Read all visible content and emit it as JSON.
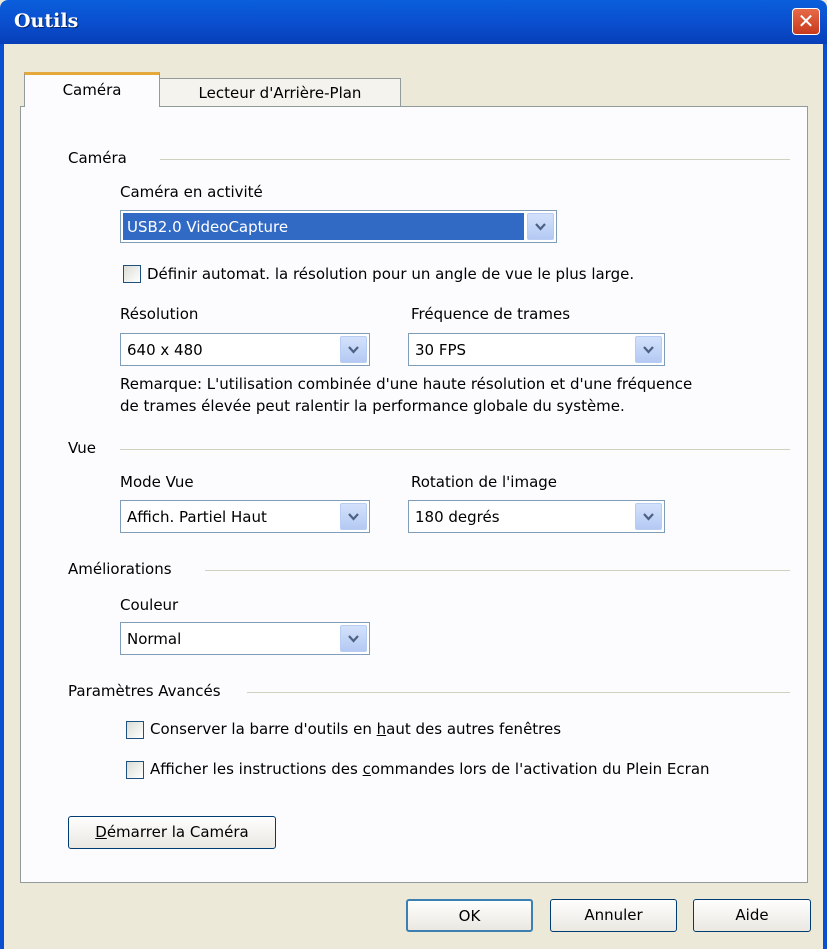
{
  "window": {
    "title": "Outils",
    "close_label": "✕"
  },
  "tabs": [
    {
      "label": "Caméra",
      "active": true
    },
    {
      "label": "Lecteur d'Arrière-Plan",
      "active": false
    }
  ],
  "camera_section": {
    "title": "Caméra",
    "active_camera_label": "Caméra en activité",
    "active_camera_value": "USB2.0 VideoCapture",
    "auto_resolution_checkbox": {
      "label": "Définir automat. la résolution pour un angle de vue le plus large.",
      "checked": false
    },
    "resolution_label": "Résolution",
    "resolution_value": "640 x 480",
    "framerate_label": "Fréquence de trames",
    "framerate_value": "30 FPS",
    "note_line1": "Remarque: L'utilisation combinée d'une haute résolution et d'une fréquence",
    "note_line2": "de trames élevée peut ralentir la performance globale du système."
  },
  "view_section": {
    "title": "Vue",
    "mode_label": "Mode Vue",
    "mode_value": "Affich. Partiel Haut",
    "rotation_label": "Rotation de l'image",
    "rotation_value": "180 degrés"
  },
  "enhancements_section": {
    "title": "Améliorations",
    "color_label": "Couleur",
    "color_value": "Normal"
  },
  "advanced_section": {
    "title": "Paramètres Avancés",
    "keep_on_top": {
      "label_pre": "Conserver la barre d'outils en ",
      "label_mnemonic": "h",
      "label_post": "aut des autres fenêtres",
      "checked": false
    },
    "show_instructions": {
      "label_pre": "Afficher les instructions des ",
      "label_mnemonic": "c",
      "label_post": "ommandes lors de l'activation du Plein Ecran",
      "checked": false
    }
  },
  "start_button": {
    "mnemonic": "D",
    "label_rest": "émarrer la Caméra"
  },
  "footer": {
    "ok": "OK",
    "cancel": "Annuler",
    "help": "Aide"
  },
  "colors": {
    "titlebar": "#0a4fcf",
    "selection": "#316ac5",
    "dialog_bg": "#ece9d8",
    "tab_highlight": "#e5a83a"
  }
}
